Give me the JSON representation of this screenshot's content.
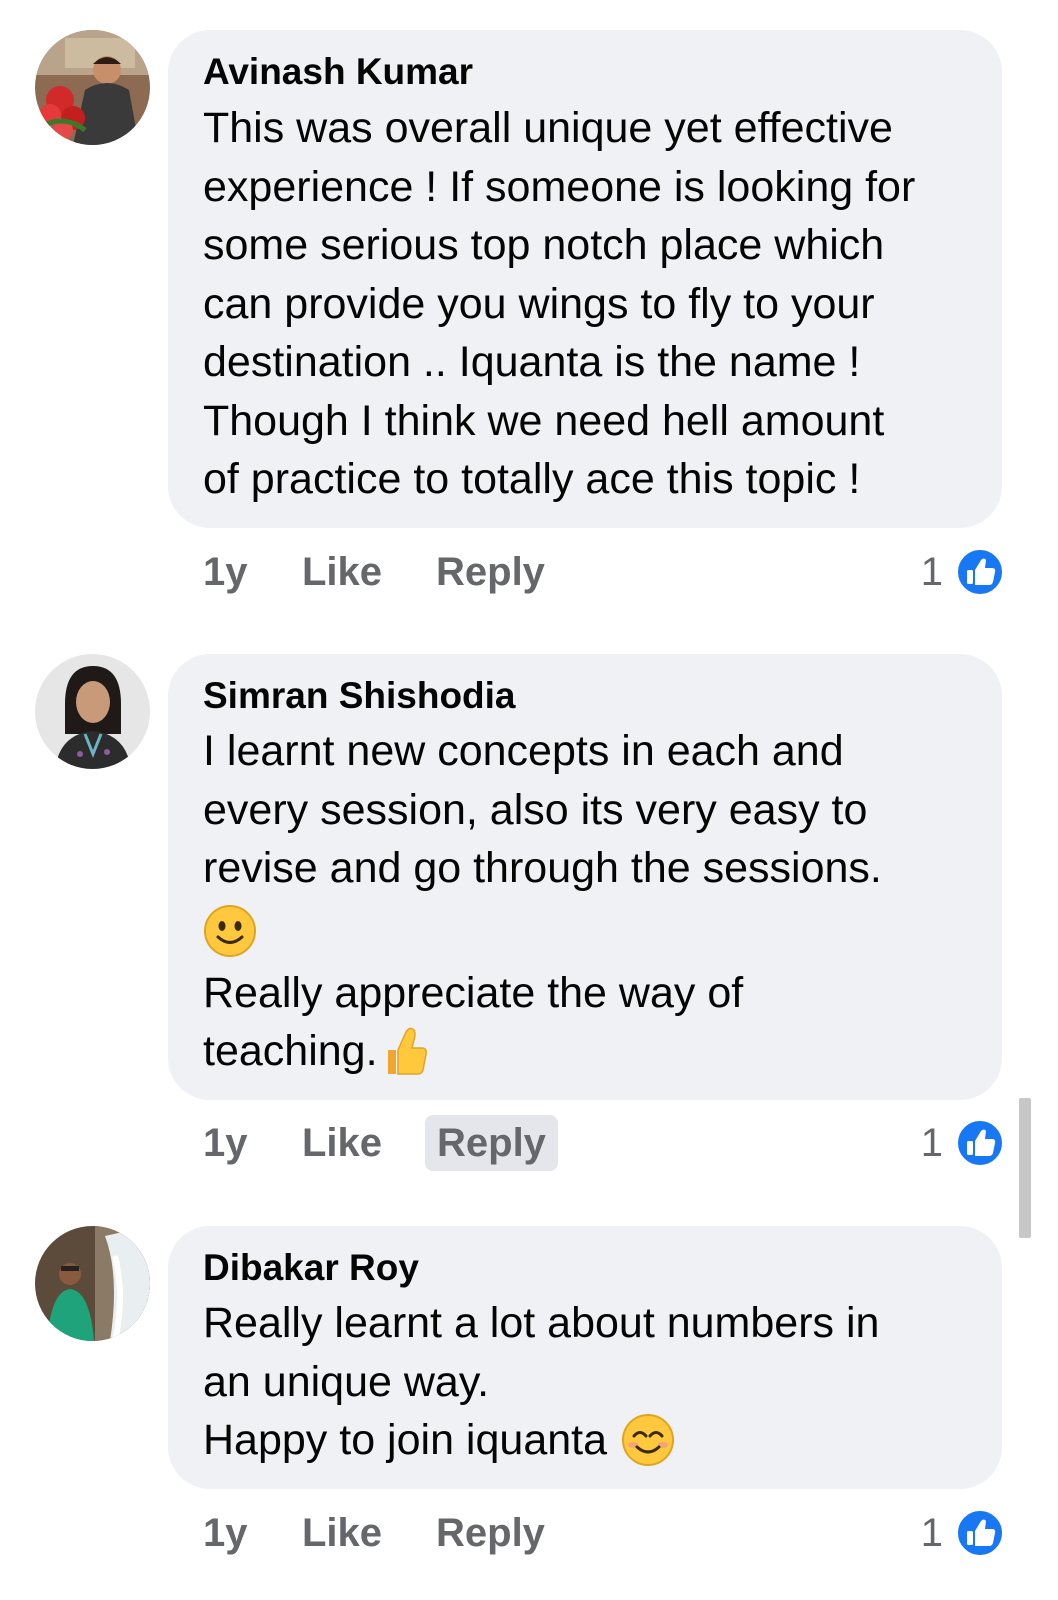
{
  "theme": {
    "bubble_bg": "#eff1f5",
    "meta_text": "#65676b",
    "like_blue": "#1877f2",
    "emoji_yellow": "#ffc83d"
  },
  "comments": [
    {
      "author": "Avinash Kumar",
      "lines": [
        "This was overall unique yet effective",
        "experience ! If someone is looking for",
        "some serious top notch place which",
        "can provide you  wings to fly to your",
        "destination  .. Iquanta is the name !",
        "Though I think we need hell amount",
        "of practice to totally ace this topic !"
      ],
      "time": "1y",
      "like_label": "Like",
      "reply_label": "Reply",
      "reaction_count": "1",
      "reaction_icon": "like-icon"
    },
    {
      "author": "Simran Shishodia",
      "lines": [
        "I learnt new concepts in each and",
        "every session, also its very easy to",
        "revise and go through the sessions.",
        "",
        "Really appreciate the way of",
        "teaching."
      ],
      "emoji_line_icon": "slightly-smiling-face-emoji",
      "end_emoji_icon": "thumbs-up-emoji",
      "time": "1y",
      "like_label": "Like",
      "reply_label": "Reply",
      "reaction_count": "1",
      "reaction_icon": "like-icon"
    },
    {
      "author": "Dibakar Roy",
      "lines": [
        "Really learnt a lot about numbers in",
        "an unique way.",
        "Happy to join iquanta"
      ],
      "end_emoji_icon": "smiling-face-with-smiling-eyes-emoji",
      "time": "1y",
      "like_label": "Like",
      "reply_label": "Reply",
      "reaction_count": "1",
      "reaction_icon": "like-icon"
    }
  ]
}
